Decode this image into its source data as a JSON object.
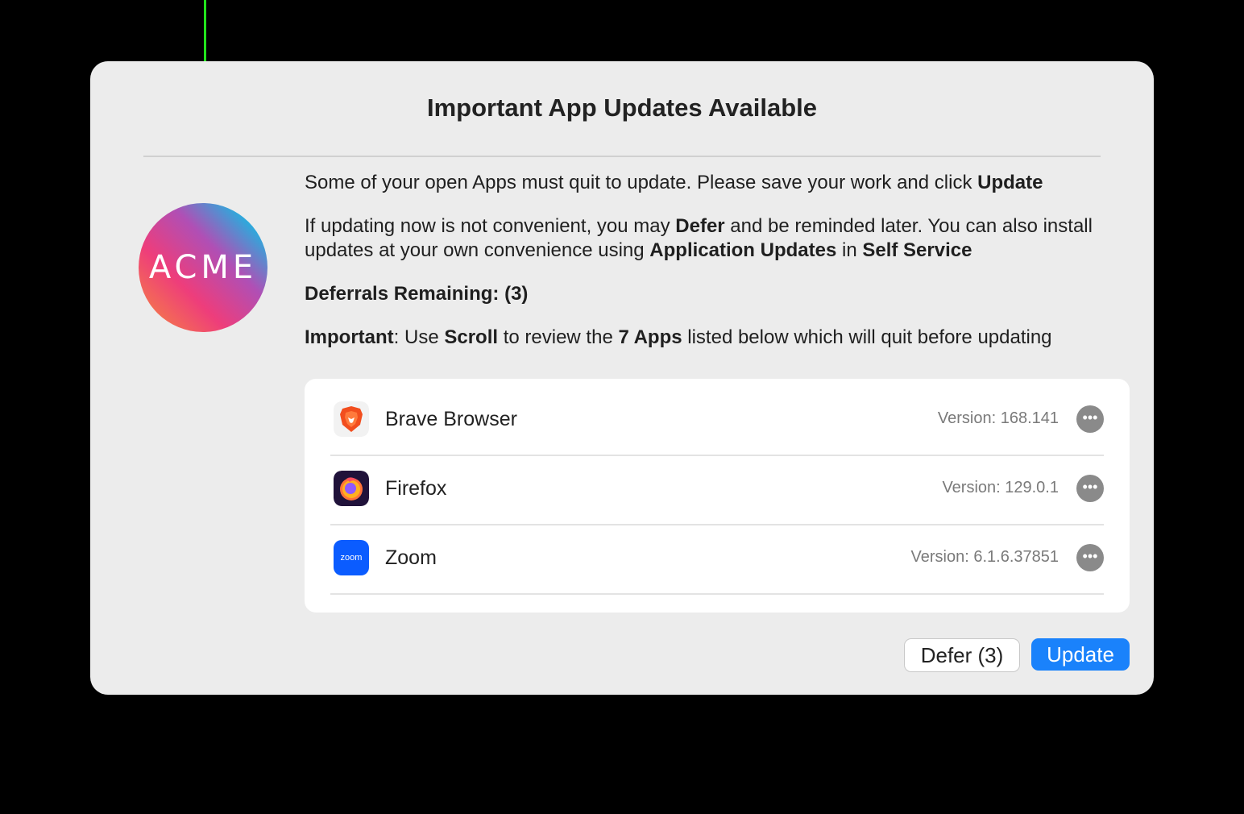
{
  "dialog": {
    "title": "Important App Updates Available",
    "logo_text": "ACME",
    "message_1": {
      "before": "Some of your open Apps must quit to update. Please save your work and click ",
      "bold": "Update"
    },
    "message_2": {
      "p1": "If updating now is not convenient, you may ",
      "b1": "Defer",
      "p2": " and be reminded later. You can also install updates at your own convenience using ",
      "b2": "Application Updates",
      "p3": " in ",
      "b3": "Self Service"
    },
    "deferrals_remaining": "Deferrals Remaining: (3)",
    "message_4": {
      "b1": "Important",
      "p1": ": Use ",
      "b2": "Scroll",
      "p2": " to review the ",
      "b3": "7 Apps",
      "p3": " listed below which will quit before updating"
    },
    "apps": [
      {
        "name": "Brave Browser",
        "version": "Version: 168.141",
        "icon": "brave-icon"
      },
      {
        "name": "Firefox",
        "version": "Version: 129.0.1",
        "icon": "firefox-icon"
      },
      {
        "name": "Zoom",
        "version": "Version: 6.1.6.37851",
        "icon": "zoom-icon",
        "icon_text": "zoom"
      }
    ],
    "more_glyph": "•••",
    "buttons": {
      "defer": "Defer (3)",
      "update": "Update"
    }
  },
  "colors": {
    "accent": "#1a82fb",
    "annotation": "#22e31c",
    "dialog_bg": "#ececec"
  }
}
